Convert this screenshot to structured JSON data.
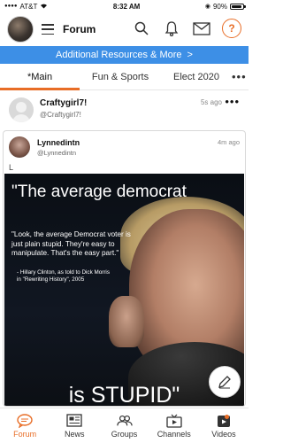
{
  "status_bar": {
    "carrier": "AT&T",
    "time": "8:32 AM",
    "battery": "90%",
    "battery_level": 0.9
  },
  "header": {
    "title": "Forum"
  },
  "banner": {
    "text": "Additional Resources & More",
    "chevron": ">"
  },
  "tabs": [
    {
      "label": "*Main",
      "active": true
    },
    {
      "label": "Fun & Sports",
      "active": false
    },
    {
      "label": "Elect 2020",
      "active": false
    }
  ],
  "tabs_more": "•••",
  "post": {
    "name": "Craftygirl7!",
    "handle": "@Craftygirl7!",
    "time": "5s ago",
    "more": "•••"
  },
  "quoted": {
    "name": "Lynnedintn",
    "handle": "@Lynnedintn",
    "time": "4m ago",
    "text": "L",
    "meme": {
      "top": "\"The average democrat",
      "quote": "\"Look, the average Democrat voter is just plain stupid. They're easy to manipulate. That's the easy part.\"",
      "attribution": "- Hillary Clinton, as told to Dick Morris in \"Rewriting History\", 2005",
      "bottom": "is STUPID\""
    }
  },
  "bottom_nav": [
    {
      "label": "Forum",
      "icon": "forum-icon",
      "active": true
    },
    {
      "label": "News",
      "icon": "news-icon",
      "active": false
    },
    {
      "label": "Groups",
      "icon": "groups-icon",
      "active": false
    },
    {
      "label": "Channels",
      "icon": "channels-icon",
      "active": false
    },
    {
      "label": "Videos",
      "icon": "videos-icon",
      "active": false
    }
  ],
  "colors": {
    "accent": "#e86d26",
    "banner": "#3d8fe6"
  }
}
